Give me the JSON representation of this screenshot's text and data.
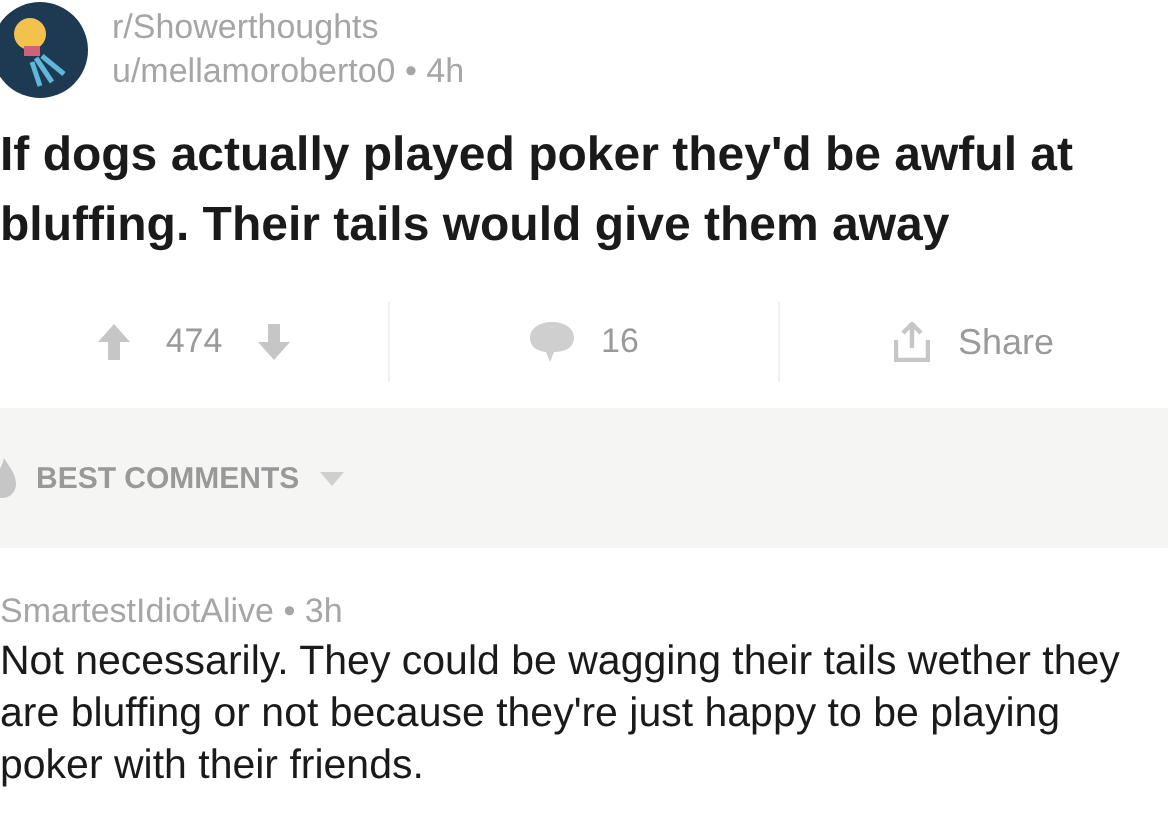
{
  "post": {
    "subreddit": "r/Showerthoughts",
    "byline": "u/mellamoroberto0 • 4h",
    "title": "If dogs actually played poker they'd be awful at bluffing. Their tails would give them away"
  },
  "actions": {
    "score": "474",
    "comments": "16",
    "share": "Share"
  },
  "sort": {
    "label": "BEST COMMENTS"
  },
  "comments": [
    {
      "byline": "SmartestIdiotAlive • 3h",
      "text": "Not necessarily. They could be wagging their tails wether they are bluffing or not because they're just happy to be playing poker with their friends."
    }
  ]
}
